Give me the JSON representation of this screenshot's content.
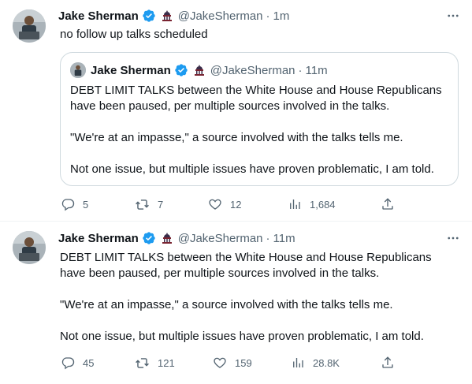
{
  "tweets": [
    {
      "author": {
        "name": "Jake Sherman",
        "handle": "@JakeSherman",
        "verified": true
      },
      "time": "1m",
      "text": [
        "no follow up talks scheduled"
      ],
      "quote": {
        "author": {
          "name": "Jake Sherman",
          "handle": "@JakeSherman"
        },
        "time": "11m",
        "paragraphs": [
          "DEBT LIMIT TALKS between the White House and House Republicans have been paused, per multiple sources involved in the talks.",
          "\"We're at an impasse,\" a source involved with the talks tells me.",
          "Not one issue, but multiple issues have proven problematic, I am told."
        ]
      },
      "metrics": {
        "replies": "5",
        "retweets": "7",
        "likes": "12",
        "views": "1,684"
      }
    },
    {
      "author": {
        "name": "Jake Sherman",
        "handle": "@JakeSherman",
        "verified": true
      },
      "time": "11m",
      "paragraphs": [
        "DEBT LIMIT TALKS between the White House and House Republicans have been paused, per multiple sources involved in the talks.",
        "\"We're at an impasse,\" a source involved with the talks tells me.",
        "Not one issue, but multiple issues have proven problematic, I am told."
      ],
      "metrics": {
        "replies": "45",
        "retweets": "121",
        "likes": "159",
        "views": "28.8K"
      }
    }
  ],
  "separator": "·",
  "icons": {
    "verified": "verified-badge-icon",
    "affiliate": "capitol-dome-icon",
    "more": "more-options-icon",
    "reply": "reply-icon",
    "retweet": "retweet-icon",
    "like": "heart-icon",
    "views": "views-chart-icon",
    "share": "share-icon"
  },
  "colors": {
    "verified": "#1d9bf0",
    "muted": "#536471",
    "text": "#0f1419",
    "border": "#cfd9de"
  }
}
